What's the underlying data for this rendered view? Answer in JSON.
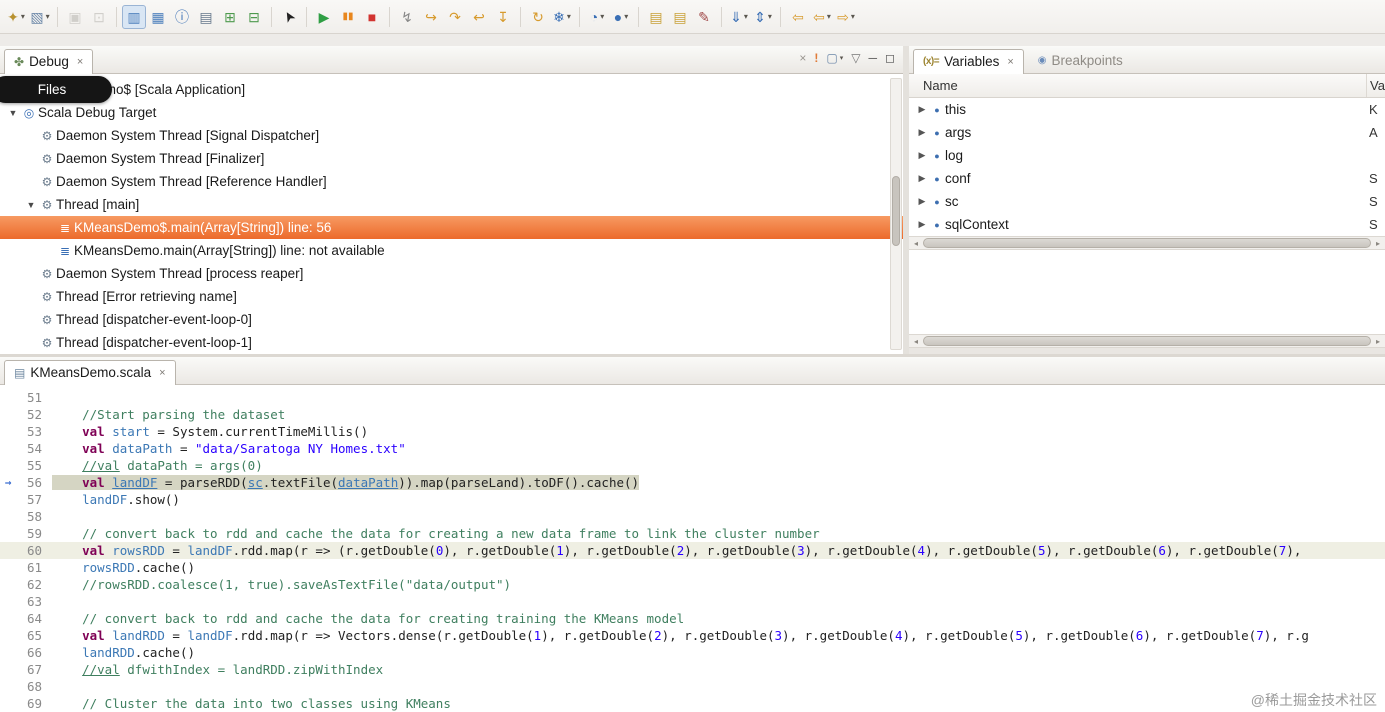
{
  "colors": {
    "selection_orange": "#ec6a2b",
    "debug_line_highlight": "#d5d5c3",
    "keyword": "#7f0055",
    "comment": "#3f7f5f",
    "string": "#2a00ff",
    "variable": "#3c78b5"
  },
  "icons": {
    "debug_tab": "✤",
    "variables_badge": "(x)=",
    "breakpoints_tab": "◉",
    "editor_tab": "▤",
    "close": "×",
    "expander_down": "▼",
    "expander_right": "▶",
    "hscroll_left": "◂",
    "hscroll_right": "▸",
    "instruction_pointer": "→"
  },
  "toolbar": {
    "groups": [
      [
        {
          "name": "new-wizard-icon",
          "glyph": "✦",
          "color": "#b8912f",
          "dropdown": true
        },
        {
          "name": "new-element-icon",
          "glyph": "▧",
          "color": "#6b87a8",
          "dropdown": true
        }
      ],
      [
        {
          "name": "save-icon",
          "glyph": "▣",
          "color": "#a6a49e",
          "disabled": true
        },
        {
          "name": "save-all-icon",
          "glyph": "⊡",
          "color": "#a6a49e",
          "disabled": true
        }
      ],
      [
        {
          "name": "console-icon",
          "glyph": "▥",
          "color": "#4f81bd",
          "pressed": true
        },
        {
          "name": "data-table-icon",
          "glyph": "▦",
          "color": "#4f81bd"
        },
        {
          "name": "info-icon",
          "glyph": "ⓘ",
          "color": "#3a6fb5"
        },
        {
          "name": "text-file-icon",
          "glyph": "▤",
          "color": "#66788c"
        },
        {
          "name": "add-console-icon",
          "glyph": "⊞",
          "color": "#4e9a4e"
        },
        {
          "name": "remove-console-icon",
          "glyph": "⊟",
          "color": "#4e9a4e"
        }
      ],
      [
        {
          "name": "pointer-icon",
          "glyph": "➤",
          "color": "#222222",
          "rot": -120
        }
      ],
      [
        {
          "name": "resume-icon",
          "glyph": "▶",
          "color": "#2f9e44"
        },
        {
          "name": "pause-icon",
          "glyph": "▮▮",
          "color": "#e8871e",
          "small": true
        },
        {
          "name": "terminate-icon",
          "glyph": "■",
          "color": "#d23430"
        }
      ],
      [
        {
          "name": "disconnect-icon",
          "glyph": "↯",
          "color": "#888888"
        },
        {
          "name": "step-into-icon",
          "glyph": "↪",
          "color": "#d79b2e"
        },
        {
          "name": "step-over-icon",
          "glyph": "↷",
          "color": "#d79b2e"
        },
        {
          "name": "step-return-icon",
          "glyph": "↩",
          "color": "#d79b2e"
        },
        {
          "name": "drop-to-frame-icon",
          "glyph": "↧",
          "color": "#d79b2e"
        }
      ],
      [
        {
          "name": "relaunch-icon",
          "glyph": "↻",
          "color": "#d79b2e"
        },
        {
          "name": "step-filters-icon",
          "glyph": "❄",
          "color": "#3a6fb5",
          "dropdown": true
        }
      ],
      [
        {
          "name": "run-history-icon",
          "glyph": "◔",
          "color": "#3a6fb5",
          "dropdown": true
        },
        {
          "name": "inspect-icon",
          "glyph": "●",
          "color": "#3a6fb5",
          "dropdown": true
        }
      ],
      [
        {
          "name": "database-icon",
          "glyph": "▤",
          "color": "#c9a23a"
        },
        {
          "name": "database-export-icon",
          "glyph": "▤",
          "color": "#c9a23a"
        },
        {
          "name": "mark-occurrences-icon",
          "glyph": "✎",
          "color": "#a04848"
        }
      ],
      [
        {
          "name": "fetch-down-icon",
          "glyph": "⇓",
          "color": "#3a6fb5",
          "dropdown": true
        },
        {
          "name": "swap-icon",
          "glyph": "⇕",
          "color": "#3a6fb5",
          "dropdown": true
        }
      ],
      [
        {
          "name": "last-edit-icon",
          "glyph": "⇦",
          "color": "#d79b2e"
        },
        {
          "name": "back-icon",
          "glyph": "⇦",
          "color": "#d79b2e",
          "dropdown": true
        },
        {
          "name": "forward-icon",
          "glyph": "⇨",
          "color": "#d79b2e",
          "dropdown": true
        }
      ]
    ]
  },
  "debug": {
    "tab_label": "Debug",
    "files_tooltip": "Files",
    "header_icons": [
      {
        "name": "clear-terminated-icon",
        "glyph": "×",
        "color": "#9a9690"
      },
      {
        "name": "warning-icon",
        "glyph": "!",
        "color": "#e07b39",
        "bold": true
      },
      {
        "name": "monitor-icon",
        "glyph": "▢",
        "color": "#6b87a8",
        "dropdown": true
      },
      {
        "name": "view-menu-icon",
        "glyph": "▽",
        "color": "#777777"
      },
      {
        "name": "minimize-icon",
        "glyph": "─",
        "color": "#555555"
      },
      {
        "name": "maximize-icon",
        "glyph": "◻",
        "color": "#555555"
      }
    ],
    "icon_glyphs": {
      "scala-app": "◈",
      "debug-target": "◎",
      "thread": "⚙",
      "stack-frame": "≣"
    },
    "icon_colors": {
      "scala-app": "#7a5fa0",
      "debug-target": "#3a6fb5",
      "thread": "#6a7b8c",
      "stack-frame": "#3a6fb5"
    },
    "tree": [
      {
        "label": "KMeansDemo$ [Scala Application]",
        "indent": 0,
        "icon": "scala-app",
        "expander": "down"
      },
      {
        "label": "Scala Debug Target",
        "indent": 0,
        "icon": "debug-target",
        "expander": "down"
      },
      {
        "label": "Daemon System Thread [Signal Dispatcher]",
        "indent": 1,
        "icon": "thread"
      },
      {
        "label": "Daemon System Thread [Finalizer]",
        "indent": 1,
        "icon": "thread"
      },
      {
        "label": "Daemon System Thread [Reference Handler]",
        "indent": 1,
        "icon": "thread"
      },
      {
        "label": "Thread [main]",
        "indent": 1,
        "icon": "thread",
        "expander": "down"
      },
      {
        "label": "KMeansDemo$.main(Array[String]) line: 56",
        "indent": 2,
        "icon": "stack-frame",
        "selected": true
      },
      {
        "label": "KMeansDemo.main(Array[String]) line: not available",
        "indent": 2,
        "icon": "stack-frame"
      },
      {
        "label": "Daemon System Thread [process reaper]",
        "indent": 1,
        "icon": "thread"
      },
      {
        "label": "Thread [Error retrieving name]",
        "indent": 1,
        "icon": "thread"
      },
      {
        "label": "Thread [dispatcher-event-loop-0]",
        "indent": 1,
        "icon": "thread"
      },
      {
        "label": "Thread [dispatcher-event-loop-1]",
        "indent": 1,
        "icon": "thread"
      }
    ]
  },
  "variables": {
    "tab_variables": "Variables",
    "tab_breakpoints": "Breakpoints",
    "col_name": "Name",
    "col_value": "Val",
    "rows": [
      {
        "name": "this",
        "value": "K"
      },
      {
        "name": "args",
        "value": "A"
      },
      {
        "name": "log",
        "value": ""
      },
      {
        "name": "conf",
        "value": "S"
      },
      {
        "name": "sc",
        "value": "S"
      },
      {
        "name": "sqlContext",
        "value": "S"
      }
    ]
  },
  "editor": {
    "tab_label": "KMeansDemo.scala",
    "code": [
      {
        "n": 51,
        "segs": []
      },
      {
        "n": 52,
        "segs": [
          [
            "    //Start parsing the dataset",
            "c"
          ]
        ]
      },
      {
        "n": 53,
        "segs": [
          [
            "    ",
            "d"
          ],
          [
            "val",
            "k"
          ],
          [
            " ",
            "d"
          ],
          [
            "start",
            "v"
          ],
          [
            " = System.currentTimeMillis()",
            "d"
          ]
        ]
      },
      {
        "n": 54,
        "segs": [
          [
            "    ",
            "d"
          ],
          [
            "val",
            "k"
          ],
          [
            " ",
            "d"
          ],
          [
            "dataPath",
            "v"
          ],
          [
            " = ",
            "d"
          ],
          [
            "\"data/Saratoga NY Homes.txt\"",
            "s"
          ]
        ]
      },
      {
        "n": 55,
        "segs": [
          [
            "    ",
            "d"
          ],
          [
            "//val",
            "cu"
          ],
          [
            " dataPath = args(0)",
            "c"
          ]
        ]
      },
      {
        "n": 56,
        "hl": "debug",
        "marker": true,
        "segs": [
          [
            "    ",
            "d"
          ],
          [
            "val",
            "k"
          ],
          [
            " ",
            "d"
          ],
          [
            "landDF",
            "u"
          ],
          [
            " = parseRDD(",
            "d"
          ],
          [
            "sc",
            "u"
          ],
          [
            ".textFile(",
            "d"
          ],
          [
            "dataPath",
            "u"
          ],
          [
            ")).map(parseLand).toDF().cache()",
            "d"
          ]
        ]
      },
      {
        "n": 57,
        "segs": [
          [
            "    ",
            "d"
          ],
          [
            "landDF",
            "v"
          ],
          [
            ".show()",
            "d"
          ]
        ]
      },
      {
        "n": 58,
        "segs": []
      },
      {
        "n": 59,
        "segs": [
          [
            "    // convert back to rdd and cache the data for creating a new data frame to link the cluster number",
            "c"
          ]
        ]
      },
      {
        "n": 60,
        "hl": "row",
        "segs": [
          [
            "    ",
            "d"
          ],
          [
            "val",
            "k"
          ],
          [
            " ",
            "d"
          ],
          [
            "rowsRDD",
            "v"
          ],
          [
            " = ",
            "d"
          ],
          [
            "landDF",
            "v"
          ],
          [
            ".rdd.map(r => (r.getDouble(",
            "d"
          ],
          [
            "0",
            "n"
          ],
          [
            "), r.getDouble(",
            "d"
          ],
          [
            "1",
            "n"
          ],
          [
            "), r.getDouble(",
            "d"
          ],
          [
            "2",
            "n"
          ],
          [
            "), r.getDouble(",
            "d"
          ],
          [
            "3",
            "n"
          ],
          [
            "), r.getDouble(",
            "d"
          ],
          [
            "4",
            "n"
          ],
          [
            "), r.getDouble(",
            "d"
          ],
          [
            "5",
            "n"
          ],
          [
            "), r.getDouble(",
            "d"
          ],
          [
            "6",
            "n"
          ],
          [
            "), r.getDouble(",
            "d"
          ],
          [
            "7",
            "n"
          ],
          [
            "),",
            "d"
          ]
        ]
      },
      {
        "n": 61,
        "segs": [
          [
            "    ",
            "d"
          ],
          [
            "rowsRDD",
            "v"
          ],
          [
            ".cache()",
            "d"
          ]
        ]
      },
      {
        "n": 62,
        "segs": [
          [
            "    //rowsRDD.coalesce(1, true).saveAsTextFile(\"data/output\")",
            "c"
          ]
        ]
      },
      {
        "n": 63,
        "segs": []
      },
      {
        "n": 64,
        "segs": [
          [
            "    // convert back to rdd and cache the data for creating training the KMeans model",
            "c"
          ]
        ]
      },
      {
        "n": 65,
        "segs": [
          [
            "    ",
            "d"
          ],
          [
            "val",
            "k"
          ],
          [
            " ",
            "d"
          ],
          [
            "landRDD",
            "v"
          ],
          [
            " = ",
            "d"
          ],
          [
            "landDF",
            "v"
          ],
          [
            ".rdd.map(r => Vectors.dense(r.getDouble(",
            "d"
          ],
          [
            "1",
            "n"
          ],
          [
            "), r.getDouble(",
            "d"
          ],
          [
            "2",
            "n"
          ],
          [
            "), r.getDouble(",
            "d"
          ],
          [
            "3",
            "n"
          ],
          [
            "), r.getDouble(",
            "d"
          ],
          [
            "4",
            "n"
          ],
          [
            "), r.getDouble(",
            "d"
          ],
          [
            "5",
            "n"
          ],
          [
            "), r.getDouble(",
            "d"
          ],
          [
            "6",
            "n"
          ],
          [
            "), r.getDouble(",
            "d"
          ],
          [
            "7",
            "n"
          ],
          [
            "), r.g",
            "d"
          ]
        ]
      },
      {
        "n": 66,
        "segs": [
          [
            "    ",
            "d"
          ],
          [
            "landRDD",
            "v"
          ],
          [
            ".cache()",
            "d"
          ]
        ]
      },
      {
        "n": 67,
        "segs": [
          [
            "    ",
            "d"
          ],
          [
            "//val",
            "cu"
          ],
          [
            " dfwithIndex = landRDD.zipWithIndex",
            "c"
          ]
        ]
      },
      {
        "n": 68,
        "segs": []
      },
      {
        "n": 69,
        "segs": [
          [
            "    // Cluster the data into two classes using KMeans",
            "c"
          ]
        ]
      }
    ]
  },
  "watermark": {
    "text": "@稀土掘金技术社区"
  }
}
